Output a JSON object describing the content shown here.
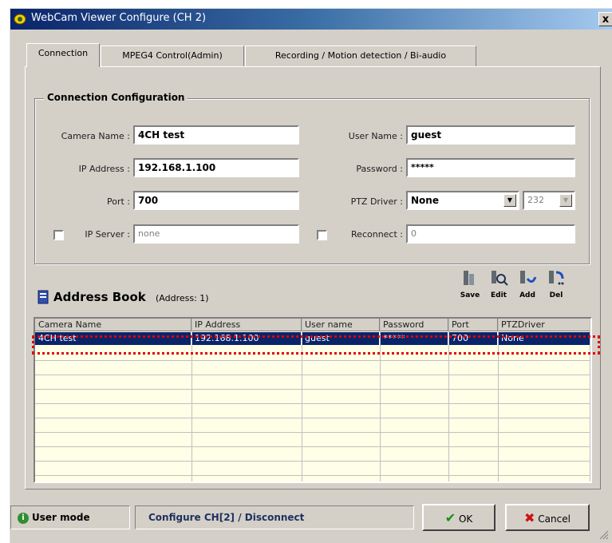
{
  "window": {
    "title": "WebCam Viewer Configure (CH 2)",
    "close_label": "x"
  },
  "tabs": [
    {
      "label": "Connection"
    },
    {
      "label": "MPEG4 Control(Admin)"
    },
    {
      "label": "Recording / Motion detection / Bi-audio"
    }
  ],
  "connection": {
    "group_title": "Connection Configuration",
    "camera_name": {
      "label": "Camera Name :",
      "value": "4CH test"
    },
    "ip_address": {
      "label": "IP Address :",
      "value": "192.168.1.100"
    },
    "port": {
      "label": "Port :",
      "value": "700"
    },
    "ip_server": {
      "label": "IP Server :",
      "value": "none",
      "checked": false
    },
    "user_name": {
      "label": "User Name :",
      "value": "guest"
    },
    "password": {
      "label": "Password :",
      "value": "*****"
    },
    "ptz_driver": {
      "label": "PTZ Driver :",
      "value": "None",
      "port_value": "232"
    },
    "reconnect": {
      "label": "Reconnect :",
      "value": "0",
      "checked": false
    }
  },
  "address_book": {
    "title": "Address Book",
    "count": "(Address: 1)",
    "toolbar": {
      "save": "Save",
      "edit": "Edit",
      "add": "Add",
      "del": "Del"
    },
    "columns": [
      "Camera Name",
      "IP Address",
      "User name",
      "Password",
      "Port",
      "PTZDriver"
    ],
    "rows": [
      [
        "4CH test",
        "192.168.1.100",
        "guest",
        "*****",
        "700",
        "None"
      ]
    ]
  },
  "status": {
    "mode": "User mode",
    "message": "Configure CH[2] / Disconnect",
    "ok_label": "OK",
    "cancel_label": "Cancel"
  },
  "colors": {
    "selection": "#0a246a",
    "grid_bg": "#ffffe7",
    "highlight": "#e00000"
  }
}
